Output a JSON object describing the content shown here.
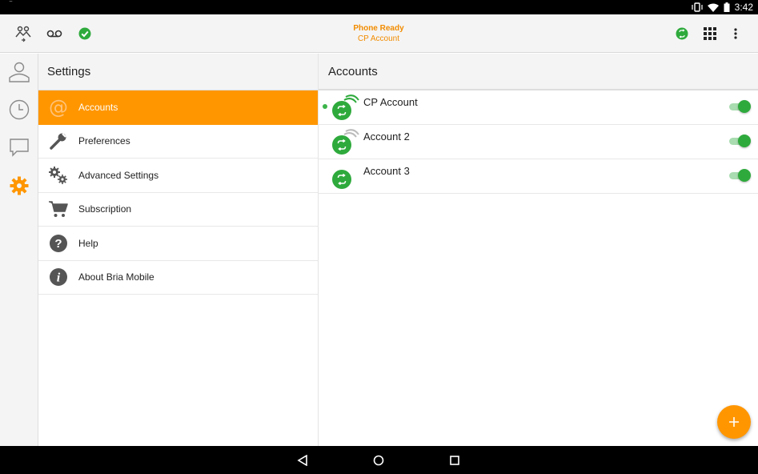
{
  "status_bar": {
    "time": "3:42"
  },
  "toolbar": {
    "status_title": "Phone Ready",
    "status_subtitle": "CP Account",
    "icons": [
      "contacts-transfer-icon",
      "voicemail-icon",
      "ready-check-icon",
      "account-status-icon",
      "dialpad-icon",
      "overflow-menu-icon"
    ]
  },
  "nav": {
    "items": [
      "contacts",
      "history",
      "messages",
      "settings"
    ],
    "active": "settings",
    "active_color": "#ff9600"
  },
  "settings": {
    "title": "Settings",
    "items": [
      {
        "label": "Accounts",
        "icon": "at-icon",
        "active": true
      },
      {
        "label": "Preferences",
        "icon": "wrench-icon"
      },
      {
        "label": "Advanced Settings",
        "icon": "gears-icon"
      },
      {
        "label": "Subscription",
        "icon": "cart-icon"
      },
      {
        "label": "Help",
        "icon": "help-icon"
      },
      {
        "label": "About Bria Mobile",
        "icon": "info-icon"
      }
    ]
  },
  "accounts": {
    "title": "Accounts",
    "items": [
      {
        "name": "CP Account",
        "enabled": true,
        "default": true
      },
      {
        "name": "Account 2",
        "enabled": true
      },
      {
        "name": "Account 3",
        "enabled": true
      }
    ]
  },
  "colors": {
    "accent": "#ff9600",
    "green": "#2eaa3c"
  }
}
